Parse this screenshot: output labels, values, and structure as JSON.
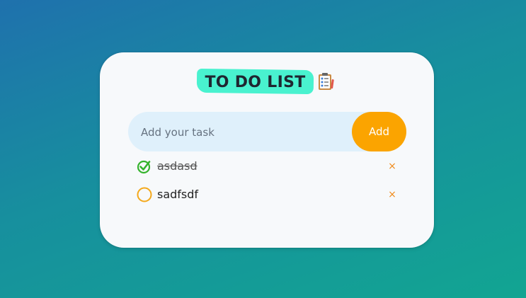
{
  "app": {
    "title": "TO DO LIST",
    "title_icon": "clipboard-icon",
    "accent_color": "#fba400",
    "title_highlight_color": "#49f2cf"
  },
  "input": {
    "placeholder": "Add your task",
    "value": ""
  },
  "add_button": {
    "label": "Add"
  },
  "tasks": [
    {
      "text": "asdasd",
      "completed": true,
      "remove_label": "×"
    },
    {
      "text": "sadfsdf",
      "completed": false,
      "remove_label": "×"
    }
  ]
}
